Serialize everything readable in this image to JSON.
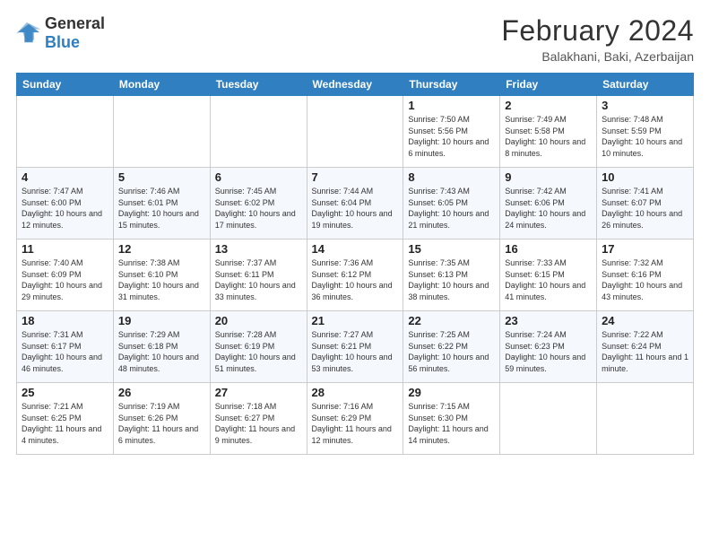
{
  "logo": {
    "line1": "General",
    "line2": "Blue"
  },
  "title": "February 2024",
  "subtitle": "Balakhani, Baki, Azerbaijan",
  "weekdays": [
    "Sunday",
    "Monday",
    "Tuesday",
    "Wednesday",
    "Thursday",
    "Friday",
    "Saturday"
  ],
  "weeks": [
    [
      {
        "day": "",
        "info": ""
      },
      {
        "day": "",
        "info": ""
      },
      {
        "day": "",
        "info": ""
      },
      {
        "day": "",
        "info": ""
      },
      {
        "day": "1",
        "info": "Sunrise: 7:50 AM\nSunset: 5:56 PM\nDaylight: 10 hours and 6 minutes."
      },
      {
        "day": "2",
        "info": "Sunrise: 7:49 AM\nSunset: 5:58 PM\nDaylight: 10 hours and 8 minutes."
      },
      {
        "day": "3",
        "info": "Sunrise: 7:48 AM\nSunset: 5:59 PM\nDaylight: 10 hours and 10 minutes."
      }
    ],
    [
      {
        "day": "4",
        "info": "Sunrise: 7:47 AM\nSunset: 6:00 PM\nDaylight: 10 hours and 12 minutes."
      },
      {
        "day": "5",
        "info": "Sunrise: 7:46 AM\nSunset: 6:01 PM\nDaylight: 10 hours and 15 minutes."
      },
      {
        "day": "6",
        "info": "Sunrise: 7:45 AM\nSunset: 6:02 PM\nDaylight: 10 hours and 17 minutes."
      },
      {
        "day": "7",
        "info": "Sunrise: 7:44 AM\nSunset: 6:04 PM\nDaylight: 10 hours and 19 minutes."
      },
      {
        "day": "8",
        "info": "Sunrise: 7:43 AM\nSunset: 6:05 PM\nDaylight: 10 hours and 21 minutes."
      },
      {
        "day": "9",
        "info": "Sunrise: 7:42 AM\nSunset: 6:06 PM\nDaylight: 10 hours and 24 minutes."
      },
      {
        "day": "10",
        "info": "Sunrise: 7:41 AM\nSunset: 6:07 PM\nDaylight: 10 hours and 26 minutes."
      }
    ],
    [
      {
        "day": "11",
        "info": "Sunrise: 7:40 AM\nSunset: 6:09 PM\nDaylight: 10 hours and 29 minutes."
      },
      {
        "day": "12",
        "info": "Sunrise: 7:38 AM\nSunset: 6:10 PM\nDaylight: 10 hours and 31 minutes."
      },
      {
        "day": "13",
        "info": "Sunrise: 7:37 AM\nSunset: 6:11 PM\nDaylight: 10 hours and 33 minutes."
      },
      {
        "day": "14",
        "info": "Sunrise: 7:36 AM\nSunset: 6:12 PM\nDaylight: 10 hours and 36 minutes."
      },
      {
        "day": "15",
        "info": "Sunrise: 7:35 AM\nSunset: 6:13 PM\nDaylight: 10 hours and 38 minutes."
      },
      {
        "day": "16",
        "info": "Sunrise: 7:33 AM\nSunset: 6:15 PM\nDaylight: 10 hours and 41 minutes."
      },
      {
        "day": "17",
        "info": "Sunrise: 7:32 AM\nSunset: 6:16 PM\nDaylight: 10 hours and 43 minutes."
      }
    ],
    [
      {
        "day": "18",
        "info": "Sunrise: 7:31 AM\nSunset: 6:17 PM\nDaylight: 10 hours and 46 minutes."
      },
      {
        "day": "19",
        "info": "Sunrise: 7:29 AM\nSunset: 6:18 PM\nDaylight: 10 hours and 48 minutes."
      },
      {
        "day": "20",
        "info": "Sunrise: 7:28 AM\nSunset: 6:19 PM\nDaylight: 10 hours and 51 minutes."
      },
      {
        "day": "21",
        "info": "Sunrise: 7:27 AM\nSunset: 6:21 PM\nDaylight: 10 hours and 53 minutes."
      },
      {
        "day": "22",
        "info": "Sunrise: 7:25 AM\nSunset: 6:22 PM\nDaylight: 10 hours and 56 minutes."
      },
      {
        "day": "23",
        "info": "Sunrise: 7:24 AM\nSunset: 6:23 PM\nDaylight: 10 hours and 59 minutes."
      },
      {
        "day": "24",
        "info": "Sunrise: 7:22 AM\nSunset: 6:24 PM\nDaylight: 11 hours and 1 minute."
      }
    ],
    [
      {
        "day": "25",
        "info": "Sunrise: 7:21 AM\nSunset: 6:25 PM\nDaylight: 11 hours and 4 minutes."
      },
      {
        "day": "26",
        "info": "Sunrise: 7:19 AM\nSunset: 6:26 PM\nDaylight: 11 hours and 6 minutes."
      },
      {
        "day": "27",
        "info": "Sunrise: 7:18 AM\nSunset: 6:27 PM\nDaylight: 11 hours and 9 minutes."
      },
      {
        "day": "28",
        "info": "Sunrise: 7:16 AM\nSunset: 6:29 PM\nDaylight: 11 hours and 12 minutes."
      },
      {
        "day": "29",
        "info": "Sunrise: 7:15 AM\nSunset: 6:30 PM\nDaylight: 11 hours and 14 minutes."
      },
      {
        "day": "",
        "info": ""
      },
      {
        "day": "",
        "info": ""
      }
    ]
  ]
}
